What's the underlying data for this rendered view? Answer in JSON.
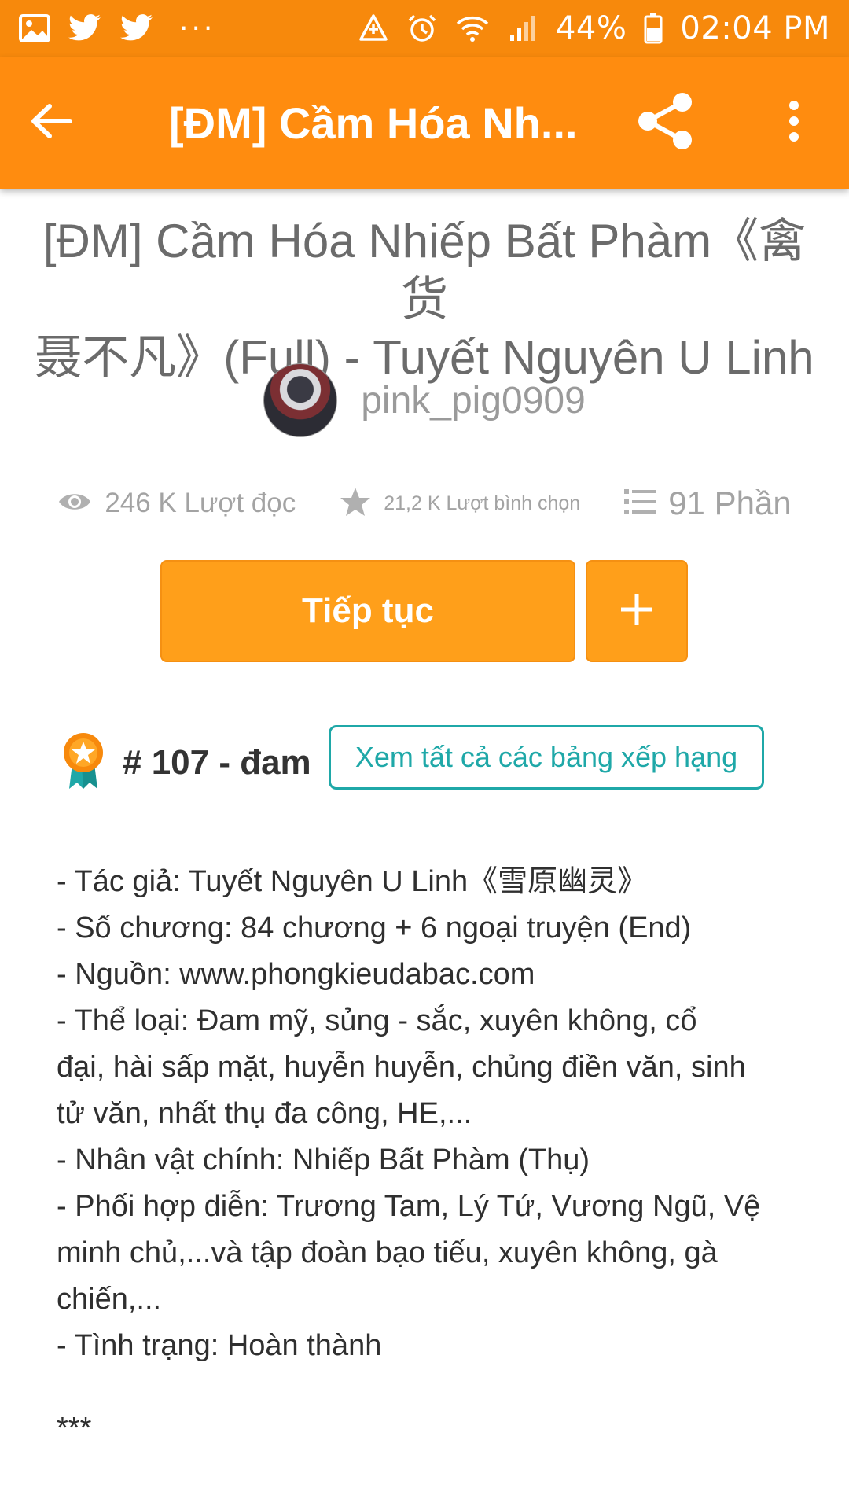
{
  "status_bar": {
    "left_icons": [
      "image-icon",
      "twitter-icon",
      "twitter-icon",
      "more-notifications-icon"
    ],
    "battery": "44%",
    "time": "02:04 PM"
  },
  "app_bar": {
    "title": "[ĐM] Cầm Hóa Nh...",
    "back_icon": "arrow-back-icon",
    "share_icon": "share-icon",
    "more_icon": "more-vert-icon"
  },
  "story": {
    "title_line1": "[ĐM] Cầm Hóa Nhiếp Bất Phàm《禽货",
    "title_line2": "聂不凡》(Full) - Tuyết Nguyên U Linh",
    "author": "pink_pig0909",
    "stats": {
      "reads": "246 K Lượt đọc",
      "votes": "21,2 K Lượt bình chọn",
      "parts": "91 Phần"
    },
    "continue_label": "Tiếp tục",
    "rank": {
      "label": "# 107 - đam",
      "view_all": "Xem tất cả các bảng xếp hạng"
    },
    "description": [
      "- Tác giả: Tuyết Nguyên U Linh《雪原幽灵》",
      "- Số chương: 84 chương + 6 ngoại truyện (End)",
      "- Nguồn: www.phongkieudabac.com",
      "- Thể loại: Đam mỹ, sủng - sắc, xuyên không, cổ",
      "đại, hài sấp mặt, huyễn huyễn, chủng điền văn, sinh",
      "tử văn, nhất thụ đa công, HE,...",
      "- Nhân vật chính: Nhiếp Bất Phàm (Thụ)",
      "- Phối hợp diễn: Trương Tam, Lý Tứ, Vương Ngũ, Vệ",
      "minh chủ,...và tập đoàn bạo tiếu, xuyên không, gà",
      "chiến,...",
      "- Tình trạng: Hoàn thành"
    ],
    "separator": "***"
  },
  "colors": {
    "status_bar": "#f7890c",
    "app_bar": "#ff8c0f",
    "button": "#ff9f1a",
    "teal": "#1fa8a8"
  }
}
